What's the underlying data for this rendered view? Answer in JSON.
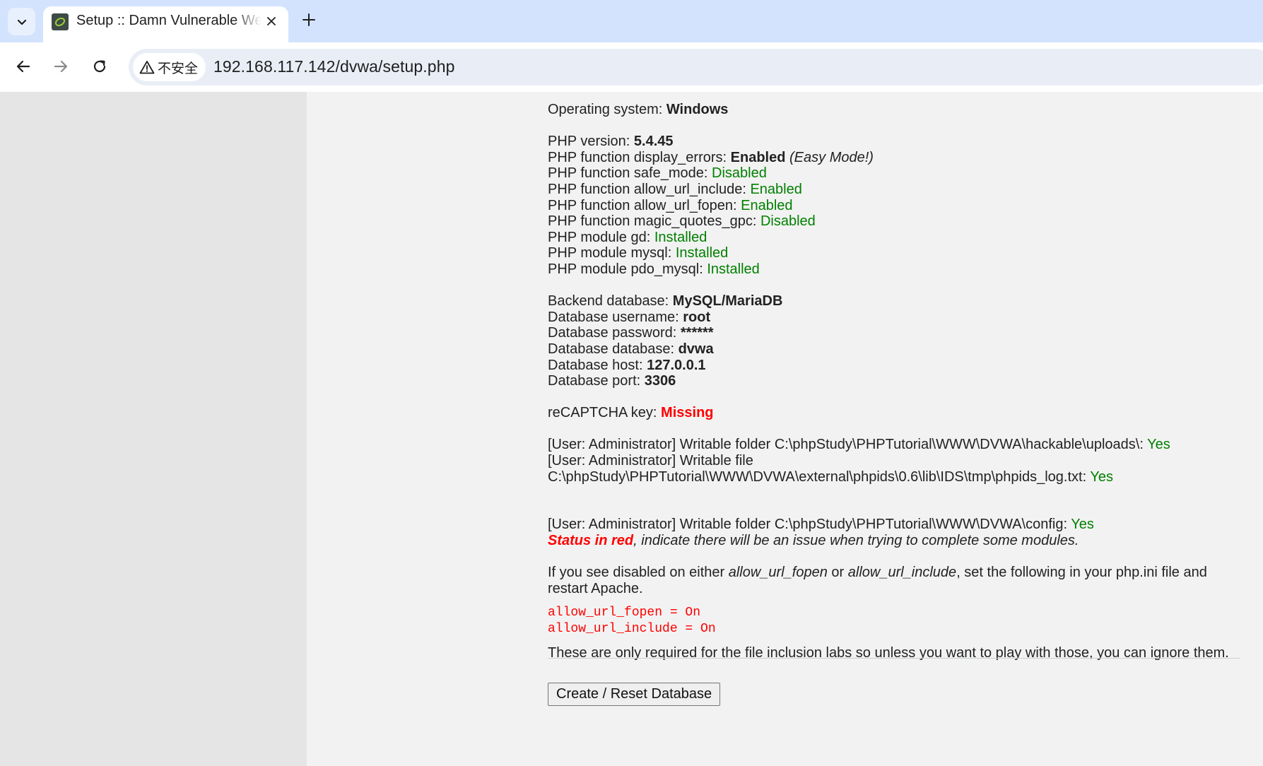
{
  "browser": {
    "tab": {
      "title": "Setup :: Damn Vulnerable Web Application (DVWA)"
    },
    "security_chip": "不安全",
    "url": {
      "host": "192.168.117.142",
      "path": "/dvwa/setup.php"
    }
  },
  "page": {
    "os": {
      "label": "Operating system: ",
      "value": "Windows"
    },
    "php": {
      "version_label": "PHP version: ",
      "version": "5.4.45",
      "display_errors_label": "PHP function display_errors: ",
      "display_errors": "Enabled",
      "easy_mode": "(Easy Mode!)",
      "safe_mode_label": "PHP function safe_mode: ",
      "safe_mode": "Disabled",
      "allow_url_include_label": "PHP function allow_url_include: ",
      "allow_url_include": "Enabled",
      "allow_url_fopen_label": "PHP function allow_url_fopen: ",
      "allow_url_fopen": "Enabled",
      "magic_quotes_label": "PHP function magic_quotes_gpc: ",
      "magic_quotes": "Disabled",
      "gd_label": "PHP module gd: ",
      "gd": "Installed",
      "mysql_label": "PHP module mysql: ",
      "mysql": "Installed",
      "pdo_label": "PHP module pdo_mysql: ",
      "pdo": "Installed"
    },
    "db": {
      "backend_label": "Backend database: ",
      "backend": "MySQL/MariaDB",
      "username_label": "Database username: ",
      "username": "root",
      "password_label": "Database password: ",
      "password": "******",
      "database_label": "Database database: ",
      "database": "dvwa",
      "host_label": "Database host: ",
      "host": "127.0.0.1",
      "port_label": "Database port: ",
      "port": "3306"
    },
    "recaptcha": {
      "label": "reCAPTCHA key: ",
      "value": "Missing"
    },
    "writable": {
      "uploads_text": "[User: Administrator] Writable folder C:\\phpStudy\\PHPTutorial\\WWW\\DVWA\\hackable\\uploads\\: ",
      "uploads_value": "Yes",
      "phpids_text_1": "[User: Administrator] Writable file",
      "phpids_text_2": "C:\\phpStudy\\PHPTutorial\\WWW\\DVWA\\external\\phpids\\0.6\\lib\\IDS\\tmp\\phpids_log.txt: ",
      "phpids_value": "Yes",
      "config_text": "[User: Administrator] Writable folder C:\\phpStudy\\PHPTutorial\\WWW\\DVWA\\config: ",
      "config_value": "Yes"
    },
    "status_note": {
      "red": "Status in red",
      "rest": ", indicate there will be an issue when trying to complete some modules."
    },
    "disabled_note": {
      "p1": "If you see disabled on either ",
      "i1": "allow_url_fopen",
      "p2": " or ",
      "i2": "allow_url_include",
      "p3": ", set the following in your php.ini file and restart Apache."
    },
    "code_lines": [
      "allow_url_fopen = On",
      "allow_url_include = On"
    ],
    "inclusion_note": "These are only required for the file inclusion labs so unless you want to play with those, you can ignore them.",
    "create_button": "Create / Reset Database"
  },
  "colors": {
    "ok": "#008000",
    "bad": "#ff0000",
    "sidebar": "#e5e5e5",
    "tabbar": "#d3e3fd"
  }
}
